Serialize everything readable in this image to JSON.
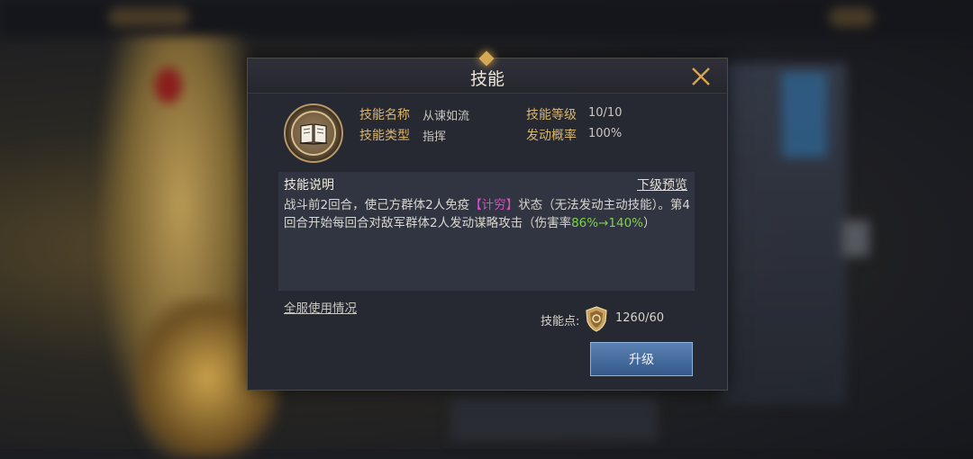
{
  "dialog": {
    "title": "技能",
    "info": {
      "name_label": "技能名称",
      "name_value": "从谏如流",
      "type_label": "技能类型",
      "type_value": "指挥",
      "level_label": "技能等级",
      "level_value": "10/10",
      "rate_label": "发动概率",
      "rate_value": "100%"
    },
    "description": {
      "title": "技能说明",
      "preview_link": "下级预览",
      "text_part1": "战斗前2回合，使己方群体2人免疫",
      "text_highlight": "【计穷】",
      "text_part2": "状态（无法发动主动技能）。第4回合开始每回合对敌军群体2人发动谋略攻击（伤害率",
      "text_green": "86%→140%",
      "text_part3": "）"
    },
    "usage_link": "全服使用情况",
    "skill_points_label": "技能点:",
    "skill_points_value": "1260/60",
    "upgrade_button": "升级"
  },
  "colors": {
    "accent_gold": "#d9b66d",
    "highlight_pink": "#d84dc8",
    "highlight_green": "#7fd24a",
    "button_blue": "#4a70a0"
  },
  "icons": {
    "close": "close-x-icon",
    "skill": "open-book-icon",
    "points": "shield-coin-icon"
  }
}
